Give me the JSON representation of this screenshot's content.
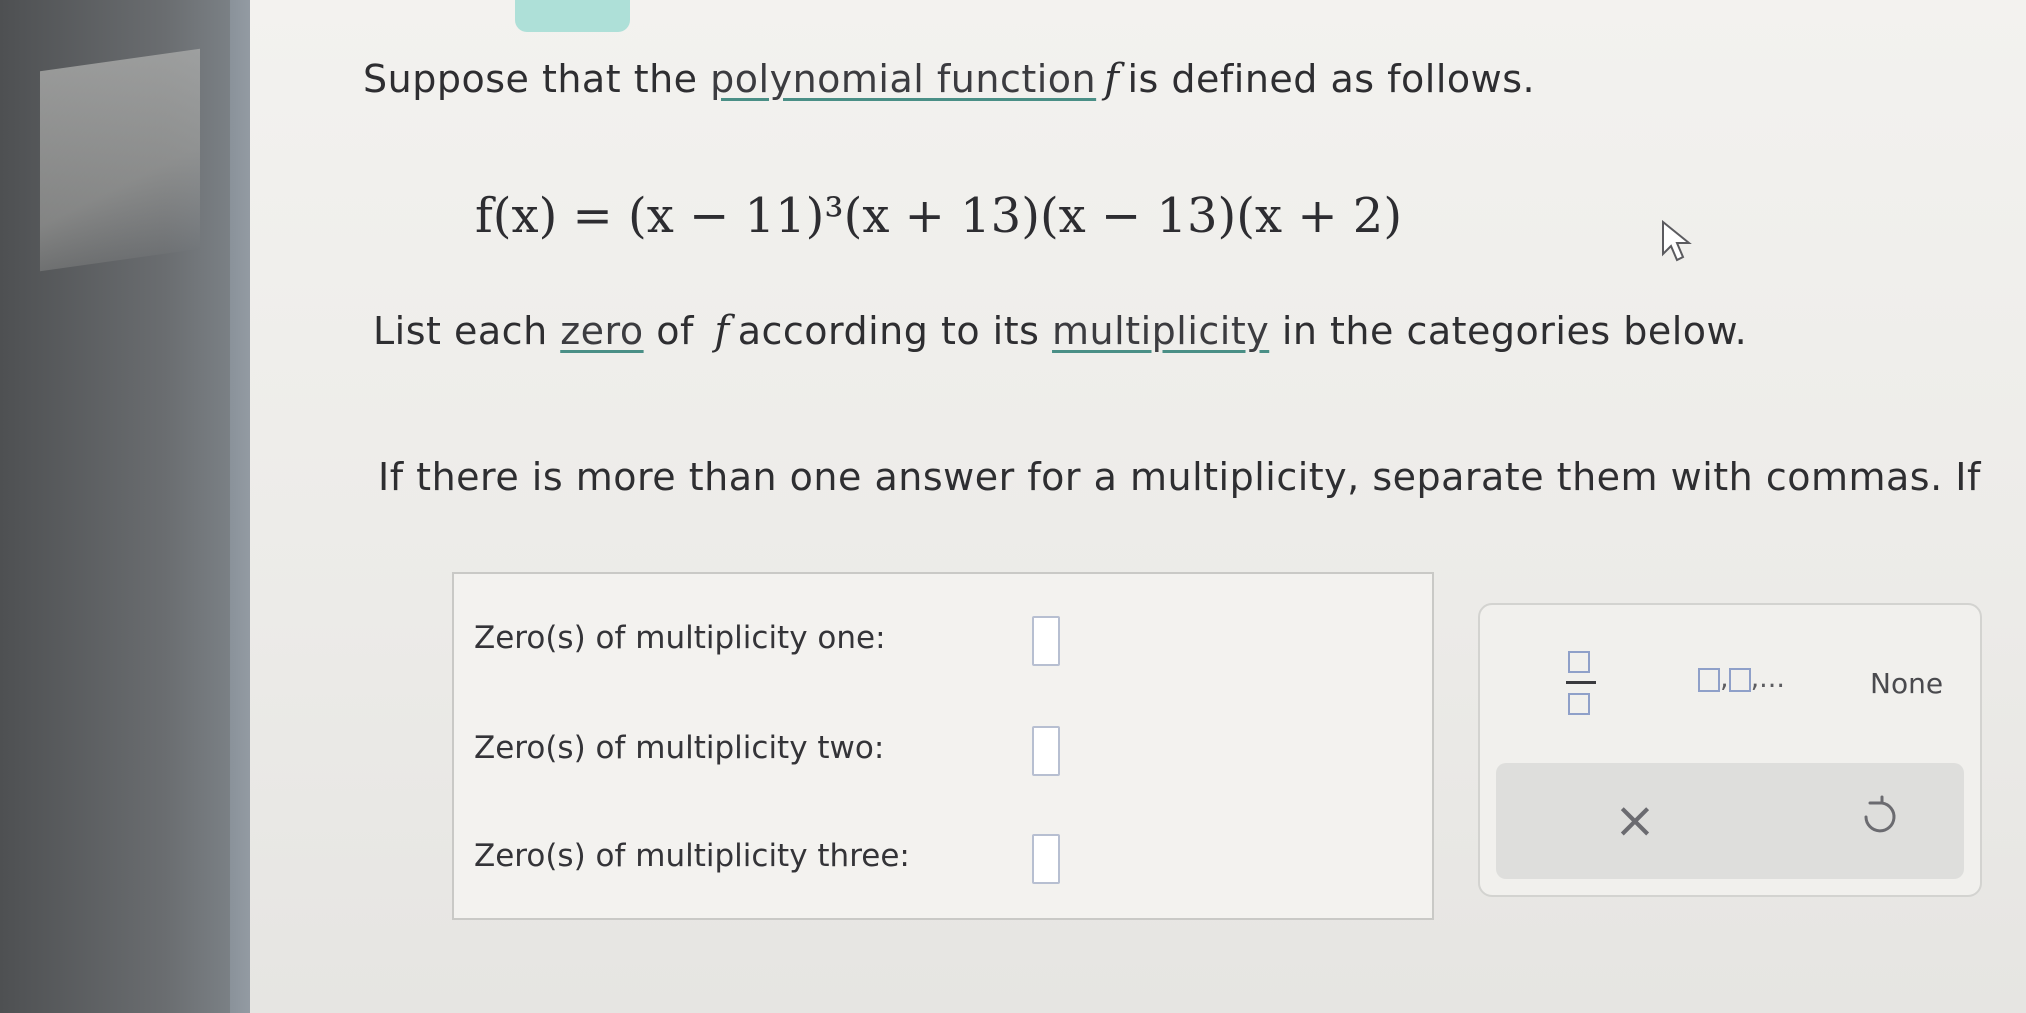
{
  "intro": {
    "prefix": "Suppose that the ",
    "term_polynomial": "polynomial function",
    "f_symbol": "f",
    "suffix": "is defined as follows."
  },
  "formula": "f(x) = (x − 11)³(x + 13)(x − 13)(x + 2)",
  "instruction": {
    "prefix": "List each ",
    "term_zero": "zero",
    "mid1": " of ",
    "f_symbol": "f",
    "mid2": "according to its ",
    "term_multiplicity": "multiplicity",
    "suffix": " in the categories below."
  },
  "note": "If there is more than one answer for a multiplicity, separate them with commas. If",
  "answers": {
    "rows": [
      {
        "label": "Zero(s) of multiplicity one:",
        "value": ""
      },
      {
        "label": "Zero(s) of multiplicity two:",
        "value": ""
      },
      {
        "label": "Zero(s) of multiplicity three:",
        "value": ""
      }
    ]
  },
  "toolbar": {
    "fraction_icon": "fraction-icon",
    "list_label": ",...",
    "none_label": "None",
    "clear_icon": "×",
    "undo_icon": "undo-icon"
  },
  "colors": {
    "accent_teal": "#aee0d8",
    "underline": "#4a8f86",
    "input_border": "#b7bfd1"
  }
}
